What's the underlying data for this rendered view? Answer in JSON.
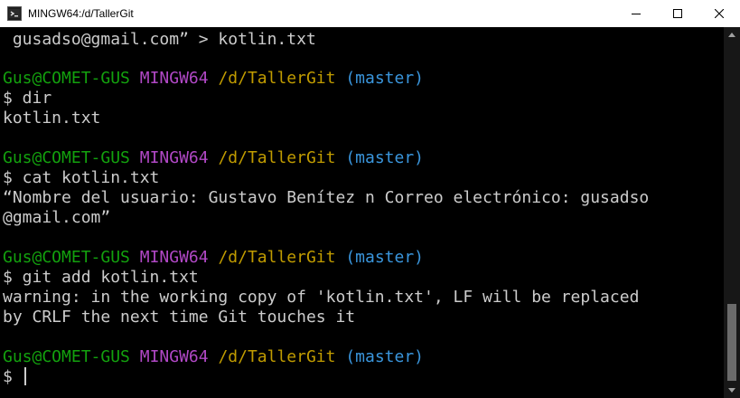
{
  "window": {
    "title": "MINGW64:/d/TallerGit"
  },
  "prompt": {
    "user": "Gus@COMET-GUS",
    "env": "MINGW64",
    "path": "/d/TallerGit",
    "branch": "(master)",
    "symbol": "$"
  },
  "lines": {
    "l0": " gusadso@gmail.com” > kotlin.txt",
    "cmd1": "$ dir",
    "out1": "kotlin.txt",
    "cmd2": "$ cat kotlin.txt",
    "out2a": "“Nombre del usuario: Gustavo Benítez n Correo electrónico: gusadso",
    "out2b": "@gmail.com”",
    "cmd3": "$ git add kotlin.txt",
    "out3a": "warning: in the working copy of 'kotlin.txt', LF will be replaced",
    "out3b": "by CRLF the next time Git touches it",
    "cmd4": "$ "
  },
  "colors": {
    "background": "#000000",
    "text": "#cccccc",
    "user": "#13a10e",
    "env": "#b148c6",
    "path": "#c19c00",
    "branch": "#3a96dd"
  },
  "icons": {
    "app": "mingw-terminal-icon",
    "minimize": "minimize-icon",
    "maximize": "maximize-icon",
    "close": "close-icon"
  }
}
